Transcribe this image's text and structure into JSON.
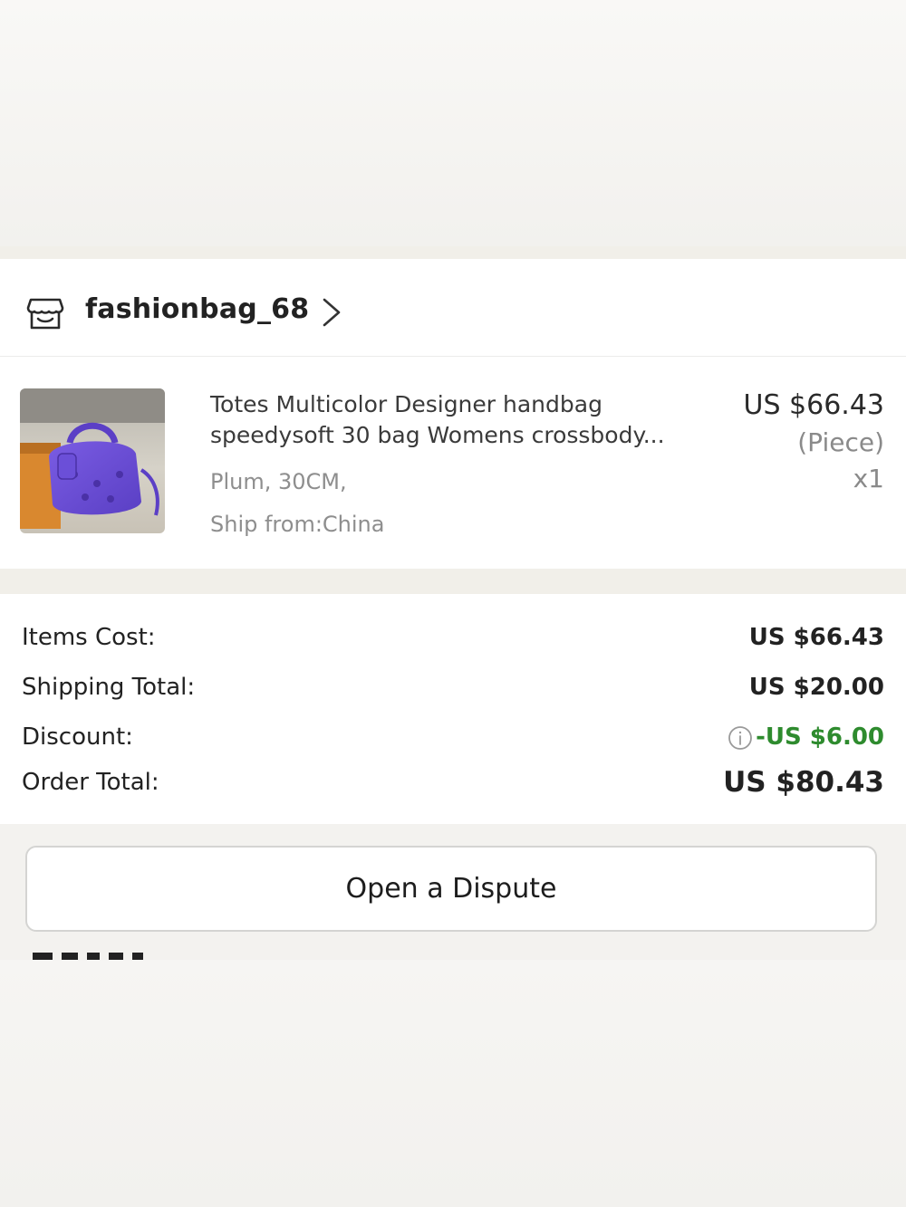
{
  "store": {
    "name": "fashionbag_68"
  },
  "product": {
    "title_line1": "Totes Multicolor Designer handbag",
    "title_line2": "speedysoft 30 bag Womens crossbody...",
    "variant": "Plum, 30CM,",
    "ship_from": "Ship from:China",
    "price": "US $66.43",
    "unit": "(Piece)",
    "quantity": "x1",
    "image_color": "#6a4bd6"
  },
  "summary": {
    "items_cost_label": "Items Cost:",
    "items_cost_value": "US $66.43",
    "shipping_label": "Shipping Total:",
    "shipping_value": "US $20.00",
    "discount_label": "Discount:",
    "discount_value": "-US $6.00",
    "order_total_label": "Order Total:",
    "order_total_value": "US $80.43"
  },
  "actions": {
    "dispute_label": "Open a Dispute"
  },
  "colors": {
    "discount_green": "#2e8b2e",
    "background": "#f3f2ef"
  },
  "icons": {
    "store": "store-icon",
    "chevron": "chevron-right-icon",
    "info": "info-icon"
  }
}
